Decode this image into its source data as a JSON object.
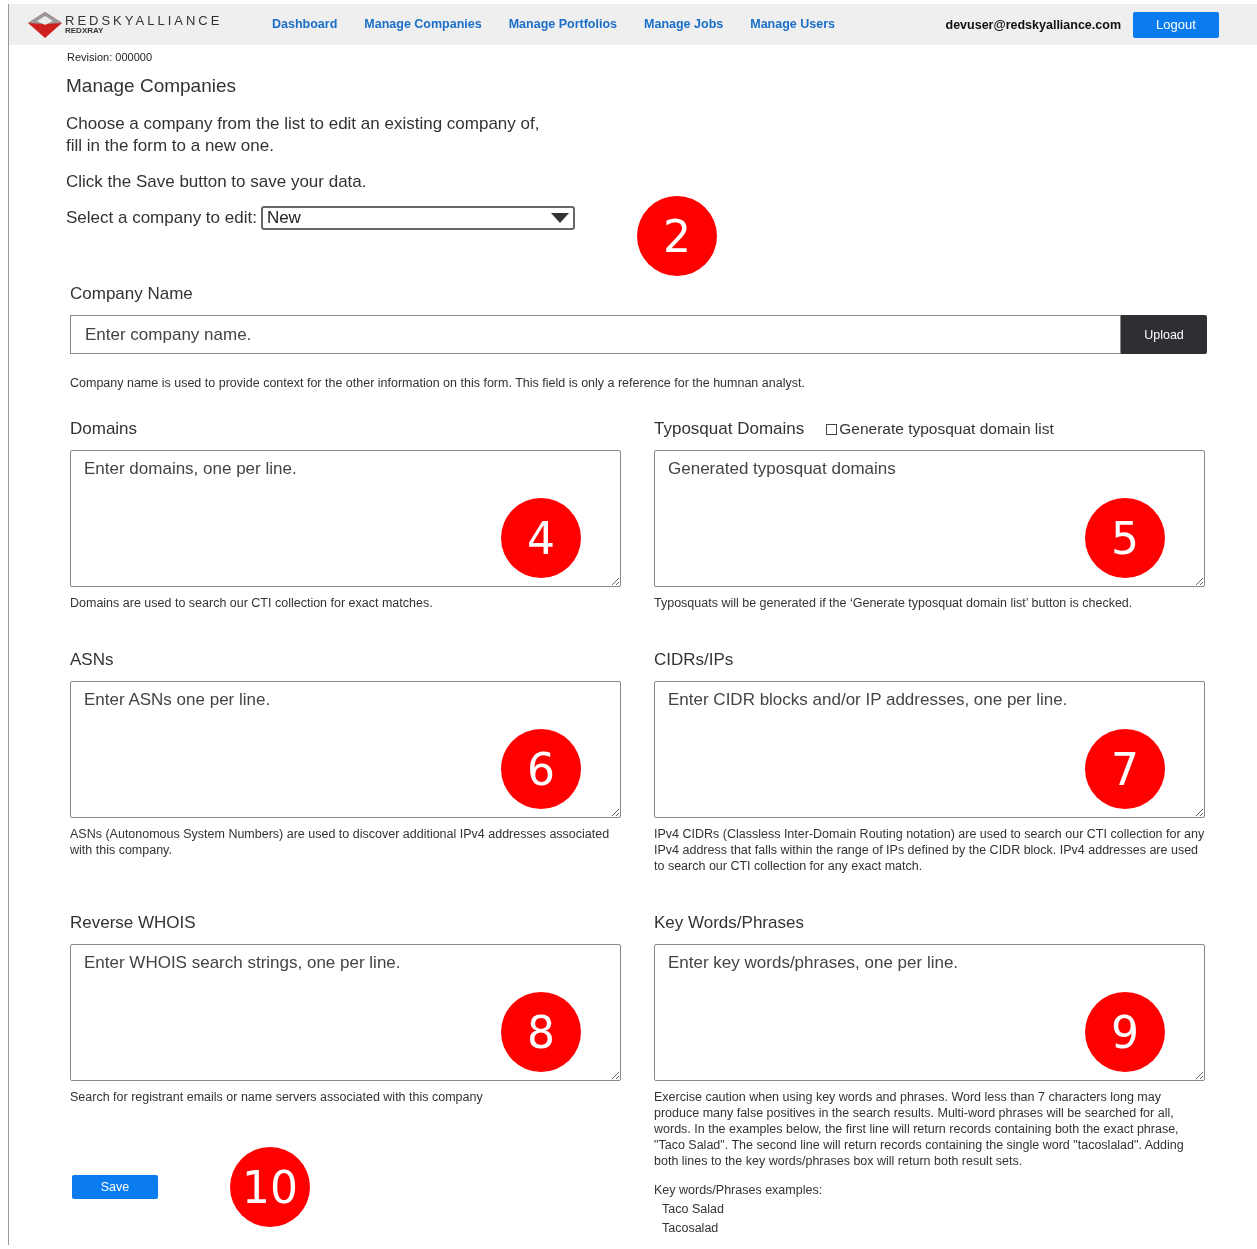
{
  "header": {
    "logo": {
      "title": "REDSKYALLIANCE",
      "subtitle": "REDXRAY"
    },
    "nav": [
      {
        "label": "Dashboard"
      },
      {
        "label": "Manage Companies"
      },
      {
        "label": "Manage Portfolios"
      },
      {
        "label": "Manage Jobs"
      },
      {
        "label": "Manage Users"
      }
    ],
    "user": "devuser@redskyalliance.com",
    "logout": "Logout"
  },
  "revision": "Revision: 000000",
  "page_title": "Manage Companies",
  "intro": "Choose a company from the list to edit an existing company of,\nfill in the form to a new one.",
  "save_hint": "Click the Save button to save your data.",
  "select": {
    "label": "Select a company to edit:",
    "value": "New",
    "callout": "2"
  },
  "company_name": {
    "label": "Company Name",
    "placeholder": "Enter company name.",
    "button": "Upload",
    "help": "Company name is used to provide context for the other information on this form. This field is only a reference for the humnan analyst."
  },
  "fields": [
    {
      "label": "Domains",
      "placeholder": "Enter domains, one per line.",
      "callout": "4",
      "help": "Domains are used to search our CTI collection for exact matches."
    },
    {
      "label": "Typosquat Domains",
      "checkbox": {
        "label": "Generate typosquat domain list",
        "checked": false
      },
      "placeholder": "Generated typosquat domains",
      "callout": "5",
      "help": "Typosquats will be generated if the ‘Generate typosquat domain list’ button is checked."
    },
    {
      "label": "ASNs",
      "placeholder": "Enter ASNs one per line.",
      "callout": "6",
      "help": "ASNs (Autonomous System Numbers) are used to discover additional IPv4 addresses associated with this company."
    },
    {
      "label": "CIDRs/IPs",
      "placeholder": "Enter CIDR blocks and/or IP addresses, one per line.",
      "callout": "7",
      "help": "IPv4 CIDRs (Classless Inter-Domain Routing notation) are used to search our CTI collection for any IPv4 address that falls within the range of IPs defined by the CIDR block. IPv4 addresses are used to search our CTI collection for any exact match."
    },
    {
      "label": "Reverse WHOIS",
      "placeholder": "Enter WHOIS search strings, one per line.",
      "callout": "8",
      "help": "Search for registrant emails or name servers associated with this company"
    },
    {
      "label": "Key Words/Phrases",
      "placeholder": "Enter key words/phrases, one per line.",
      "callout": "9",
      "help": "Exercise caution when using key words and phrases. Word less than 7 characters long may produce many false positives in the search results. Multi-word phrases will be searched for all, words. In the examples below, the first line will return records containing both the exact phrase, \"Taco Salad\". The second line will return records containing the single word \"tacoslalad\". Adding both lines to the key words/phrases box will return both result sets.",
      "examples": {
        "title": "Key words/Phrases examples:",
        "items": [
          "Taco Salad",
          "Tacosalad"
        ]
      }
    }
  ],
  "save": {
    "label": "Save",
    "callout": "10"
  }
}
